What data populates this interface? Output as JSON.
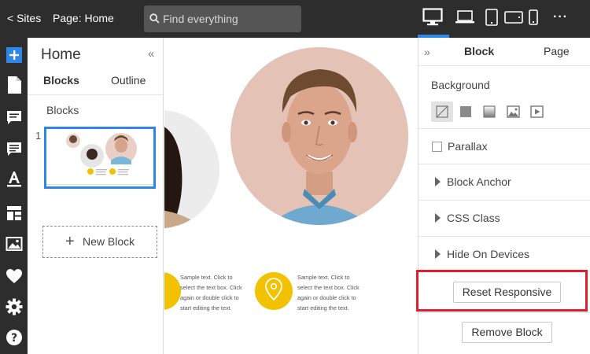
{
  "topbar": {
    "back_label": "< Sites",
    "page_label": "Page: Home",
    "search_placeholder": "Find everything",
    "devices": [
      "desktop-icon",
      "laptop-icon",
      "tablet-portrait-icon",
      "tablet-landscape-icon",
      "phone-icon"
    ],
    "active_device": "desktop",
    "more": "···"
  },
  "rail": {
    "icons": [
      "add-icon",
      "page-icon",
      "comment-icon",
      "text-block-icon",
      "font-icon",
      "layout-icon",
      "image-icon",
      "heart-icon",
      "gear-icon",
      "help-icon"
    ]
  },
  "pages_panel": {
    "title": "Home",
    "tabs": [
      "Blocks",
      "Outline"
    ],
    "active_tab": "Blocks",
    "section_label": "Blocks",
    "thumbnail_number": "1",
    "new_block_label": "New Block"
  },
  "canvas": {
    "sample_text_1": "Sample text. Click to select the text box. Click again or double click to start editing the text.",
    "sample_text_2": "Sample text. Click to select the text box. Click again or double click to start editing the text.",
    "accent_color": "#f2c200"
  },
  "props_panel": {
    "tabs": [
      "Block",
      "Page"
    ],
    "active_tab": "Block",
    "background_label": "Background",
    "background_options": [
      "none-icon",
      "color-icon",
      "gradient-icon",
      "image-icon",
      "video-icon"
    ],
    "parallax_label": "Parallax",
    "sections": [
      "Block Anchor",
      "CSS Class",
      "Hide On Devices"
    ],
    "reset_button": "Reset Responsive",
    "remove_button": "Remove Block"
  },
  "colors": {
    "topbar": "#2d2d2d",
    "accent_blue": "#2f86e6",
    "highlight_red": "#e01e2d"
  }
}
